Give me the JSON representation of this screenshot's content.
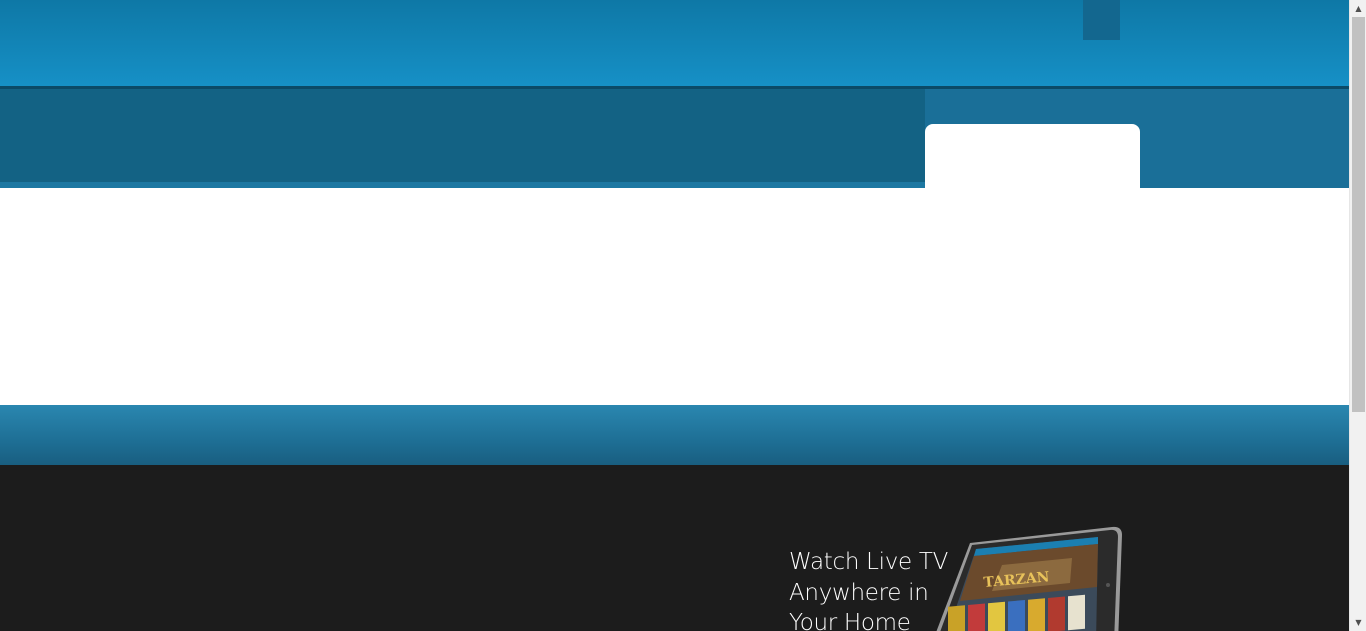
{
  "colors": {
    "header": "#1690c6",
    "nav_dark": "#136284",
    "nav_right": "#1a6f98",
    "strip": "#1e6f95",
    "dark_section": "#1c1c1c"
  },
  "promo": {
    "line1": "Watch Live TV",
    "line2": "Anywhere in",
    "line3": "Your Home"
  },
  "tablet_screen": {
    "title": "TARZAN"
  },
  "scrollbar": {
    "up_arrow": "▲",
    "down_arrow": "▼"
  }
}
